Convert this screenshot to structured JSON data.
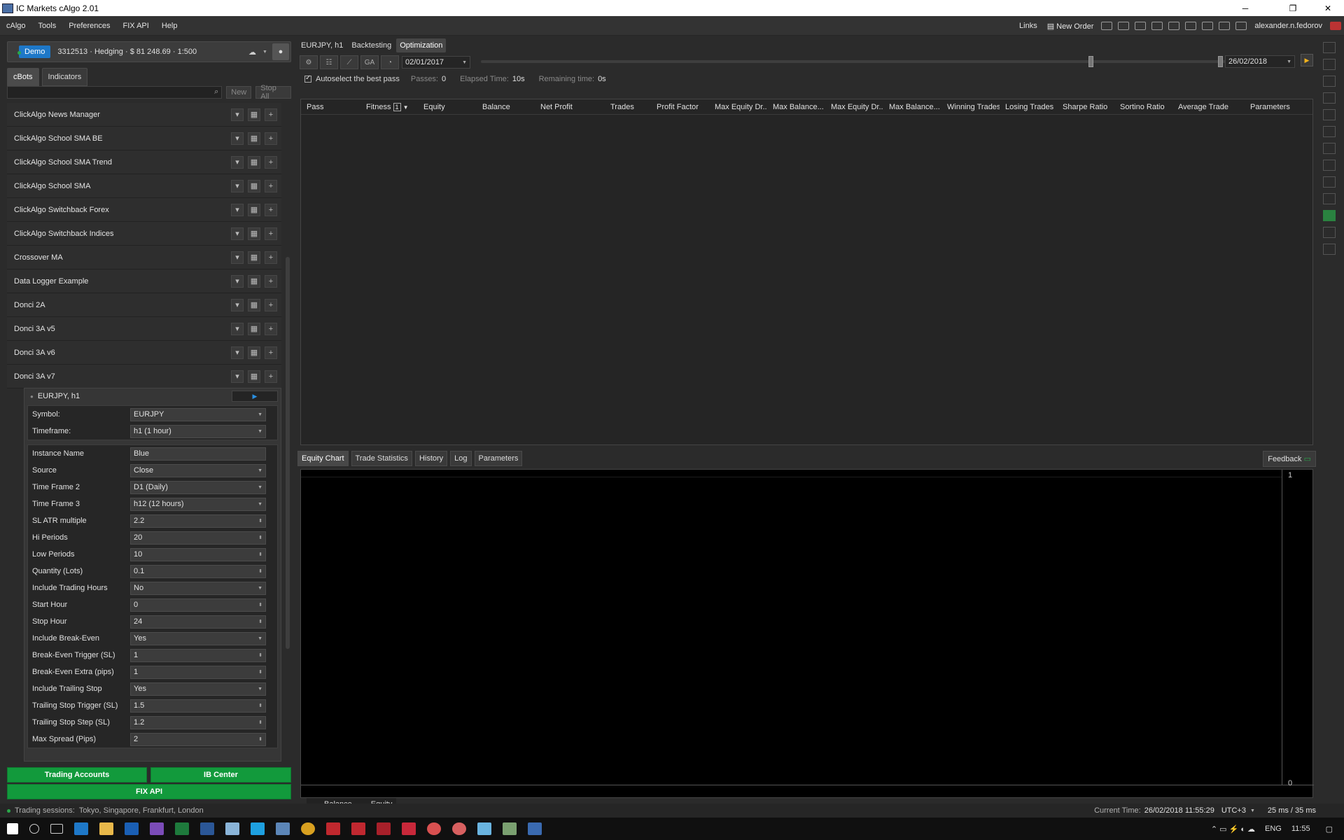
{
  "window": {
    "title": "IC Markets cAlgo 2.01"
  },
  "menu": [
    "cAlgo",
    "Tools",
    "Preferences",
    "FIX API",
    "Help"
  ],
  "topbar": {
    "links": "Links",
    "new_order": "New Order",
    "user": "alexander.n.fedorov"
  },
  "account": {
    "mode": "Demo",
    "info": "3312513 · Hedging · $ 81 248.69 · 1:500"
  },
  "left_tabs": [
    "cBots",
    "Indicators"
  ],
  "search": {
    "new_label": "New",
    "stop_all_label": "Stop All"
  },
  "bots": [
    "ClickAlgo News Manager",
    "ClickAlgo School SMA BE",
    "ClickAlgo School SMA Trend",
    "ClickAlgo School SMA",
    "ClickAlgo Switchback Forex",
    "ClickAlgo Switchback Indices",
    "Crossover MA",
    "Data Logger Example",
    "Donci 2A",
    "Donci 3A v5",
    "Donci 3A v6",
    "Donci 3A v7"
  ],
  "instance": {
    "title": "EURJPY, h1",
    "symbol_label": "Symbol:",
    "symbol": "EURJPY",
    "timeframe_label": "Timeframe:",
    "timeframe": "h1 (1 hour)",
    "params": [
      {
        "label": "Instance Name",
        "value": "Blue"
      },
      {
        "label": "Source",
        "value": "Close"
      },
      {
        "label": "Time Frame 2",
        "value": "D1 (Daily)"
      },
      {
        "label": "Time Frame 3",
        "value": "h12 (12 hours)"
      },
      {
        "label": "SL ATR multiple",
        "value": "2.2"
      },
      {
        "label": "Hi Periods",
        "value": "20"
      },
      {
        "label": "Low Periods",
        "value": "10"
      },
      {
        "label": "Quantity (Lots)",
        "value": "0.1"
      },
      {
        "label": "Include Trading Hours",
        "value": "No"
      },
      {
        "label": "Start Hour",
        "value": "0"
      },
      {
        "label": "Stop Hour",
        "value": "24"
      },
      {
        "label": "Include Break-Even",
        "value": "Yes"
      },
      {
        "label": "Break-Even Trigger (SL)",
        "value": "1"
      },
      {
        "label": "Break-Even Extra (pips)",
        "value": "1"
      },
      {
        "label": "Include Trailing Stop",
        "value": "Yes"
      },
      {
        "label": "Trailing Stop Trigger (SL)",
        "value": "1.5"
      },
      {
        "label": "Trailing Stop Step (SL)",
        "value": "1.2"
      },
      {
        "label": "Max Spread (Pips)",
        "value": "2"
      }
    ]
  },
  "bottom_buttons": {
    "trading_accounts": "Trading Accounts",
    "ib_center": "IB Center",
    "fix_api": "FIX API"
  },
  "opt_tabs": [
    "EURJPY, h1",
    "Backtesting",
    "Optimization"
  ],
  "opt": {
    "ga_label": "GA",
    "start_date": "02/01/2017",
    "end_date": "26/02/2018",
    "autoselect": "Autoselect the best pass",
    "passes_label": "Passes:",
    "passes": "0",
    "elapsed_label": "Elapsed Time:",
    "elapsed": "10s",
    "remaining_label": "Remaining time:",
    "remaining": "0s"
  },
  "columns": [
    "Pass",
    "Fitness",
    "Equity",
    "Balance",
    "Net Profit",
    "Trades",
    "Profit Factor",
    "Max Equity Dr...",
    "Max Balance...",
    "Max Equity Dr...",
    "Max Balance...",
    "Winning Trades",
    "Losing Trades",
    "Sharpe Ratio",
    "Sortino Ratio",
    "Average Trade",
    "Parameters"
  ],
  "fitness_badge": "1",
  "result_tabs": [
    "Equity Chart",
    "Trade Statistics",
    "History",
    "Log",
    "Parameters"
  ],
  "feedback": "Feedback",
  "chart": {
    "y_top": "1",
    "y_bottom": "0",
    "legend": [
      {
        "name": "Balance",
        "color": "#f0d21a"
      },
      {
        "name": "Equity",
        "color": "#6b6b6b"
      }
    ]
  },
  "status": {
    "sessions_label": "Trading sessions:",
    "sessions": "Tokyo, Singapore, Frankfurt, London",
    "time_label": "Current Time:",
    "time": "26/02/2018 11:55:29",
    "tz": "UTC+3",
    "latency": "25 ms / 35 ms"
  },
  "taskbar": {
    "lang": "ENG",
    "clock": "11:55"
  }
}
